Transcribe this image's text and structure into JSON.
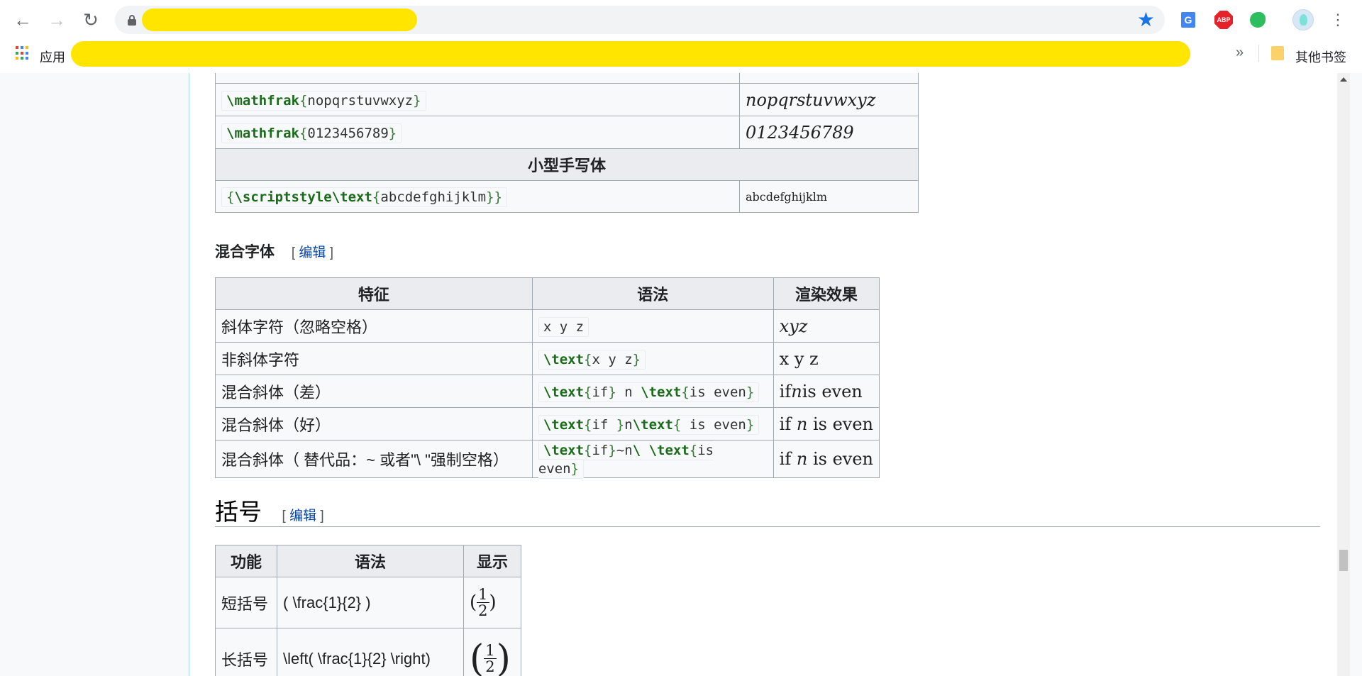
{
  "browser": {
    "star_icon": "star-icon",
    "apps_label": "应用",
    "chevron": "»",
    "other_bookmarks": "其他书签",
    "extensions": {
      "translate": "G",
      "abp": "ABP"
    }
  },
  "frak_table": {
    "partial_top_render": "",
    "rows": [
      {
        "cmd": "\\mathfrak",
        "open": "{",
        "arg": "nopqrstuvwxyz",
        "close": "}",
        "render": "nopqrstuvwxyz"
      },
      {
        "cmd": "\\mathfrak",
        "open": "{",
        "arg": "0123456789",
        "close": "}",
        "render": "0123456789"
      }
    ],
    "section_header": "小型手写体",
    "script_row": {
      "open1": "{",
      "cmd1": "\\scriptstyle",
      "cmd2": "\\text",
      "open2": "{",
      "arg": "abcdefghijklm",
      "close": "}}",
      "render": "abcdefghijklm"
    }
  },
  "mixed_section": {
    "title": "混合字体",
    "edit_open": "[",
    "edit_label": "编辑",
    "edit_close": "]"
  },
  "mixed_table": {
    "headers": [
      "特征",
      "语法",
      "渲染效果"
    ],
    "rows": [
      {
        "feature": "斜体字符（忽略空格）",
        "syntax": "x y z",
        "render": "xyz"
      },
      {
        "feature": "非斜体字符",
        "cmd": "\\text",
        "arg": "x y z",
        "render": "x y z"
      },
      {
        "feature": "混合斜体（差）",
        "render_a": "if",
        "render_b": "n",
        "render_c": "is even"
      },
      {
        "feature": "混合斜体（好）",
        "render_a": "if ",
        "render_b": "n",
        "render_c": " is even"
      },
      {
        "feature": "混合斜体（ 替代品：~ 或者\"\\ \"强制空格）",
        "render_a": "if ",
        "render_b": "n",
        "render_c": " is even"
      }
    ],
    "syntax_bad": {
      "cmd1": "\\text",
      "arg1": "if",
      "mid": " n ",
      "cmd2": "\\text",
      "arg2": "is even"
    },
    "syntax_good": {
      "cmd1": "\\text",
      "arg1": "if ",
      "mid": "n",
      "cmd2": "\\text",
      "arg2": " is even"
    },
    "syntax_alt": {
      "cmd1": "\\text",
      "arg1": "if",
      "mid": "~n",
      "cmd2": "\\ \\text",
      "arg2": "is even"
    }
  },
  "brackets_section": {
    "title": "括号",
    "edit_open": "[",
    "edit_label": "编辑",
    "edit_close": "]"
  },
  "brackets_table": {
    "headers": [
      "功能",
      "语法",
      "显示"
    ],
    "rows": [
      {
        "function": "短括号",
        "syntax": "( \\frac{1}{2} )",
        "num": "1",
        "den": "2",
        "lparen": "(",
        "rparen": ")"
      },
      {
        "function": "长括号",
        "syntax": "\\left( \\frac{1}{2} \\right)",
        "num": "1",
        "den": "2",
        "lparen": "(",
        "rparen": ")"
      }
    ]
  }
}
